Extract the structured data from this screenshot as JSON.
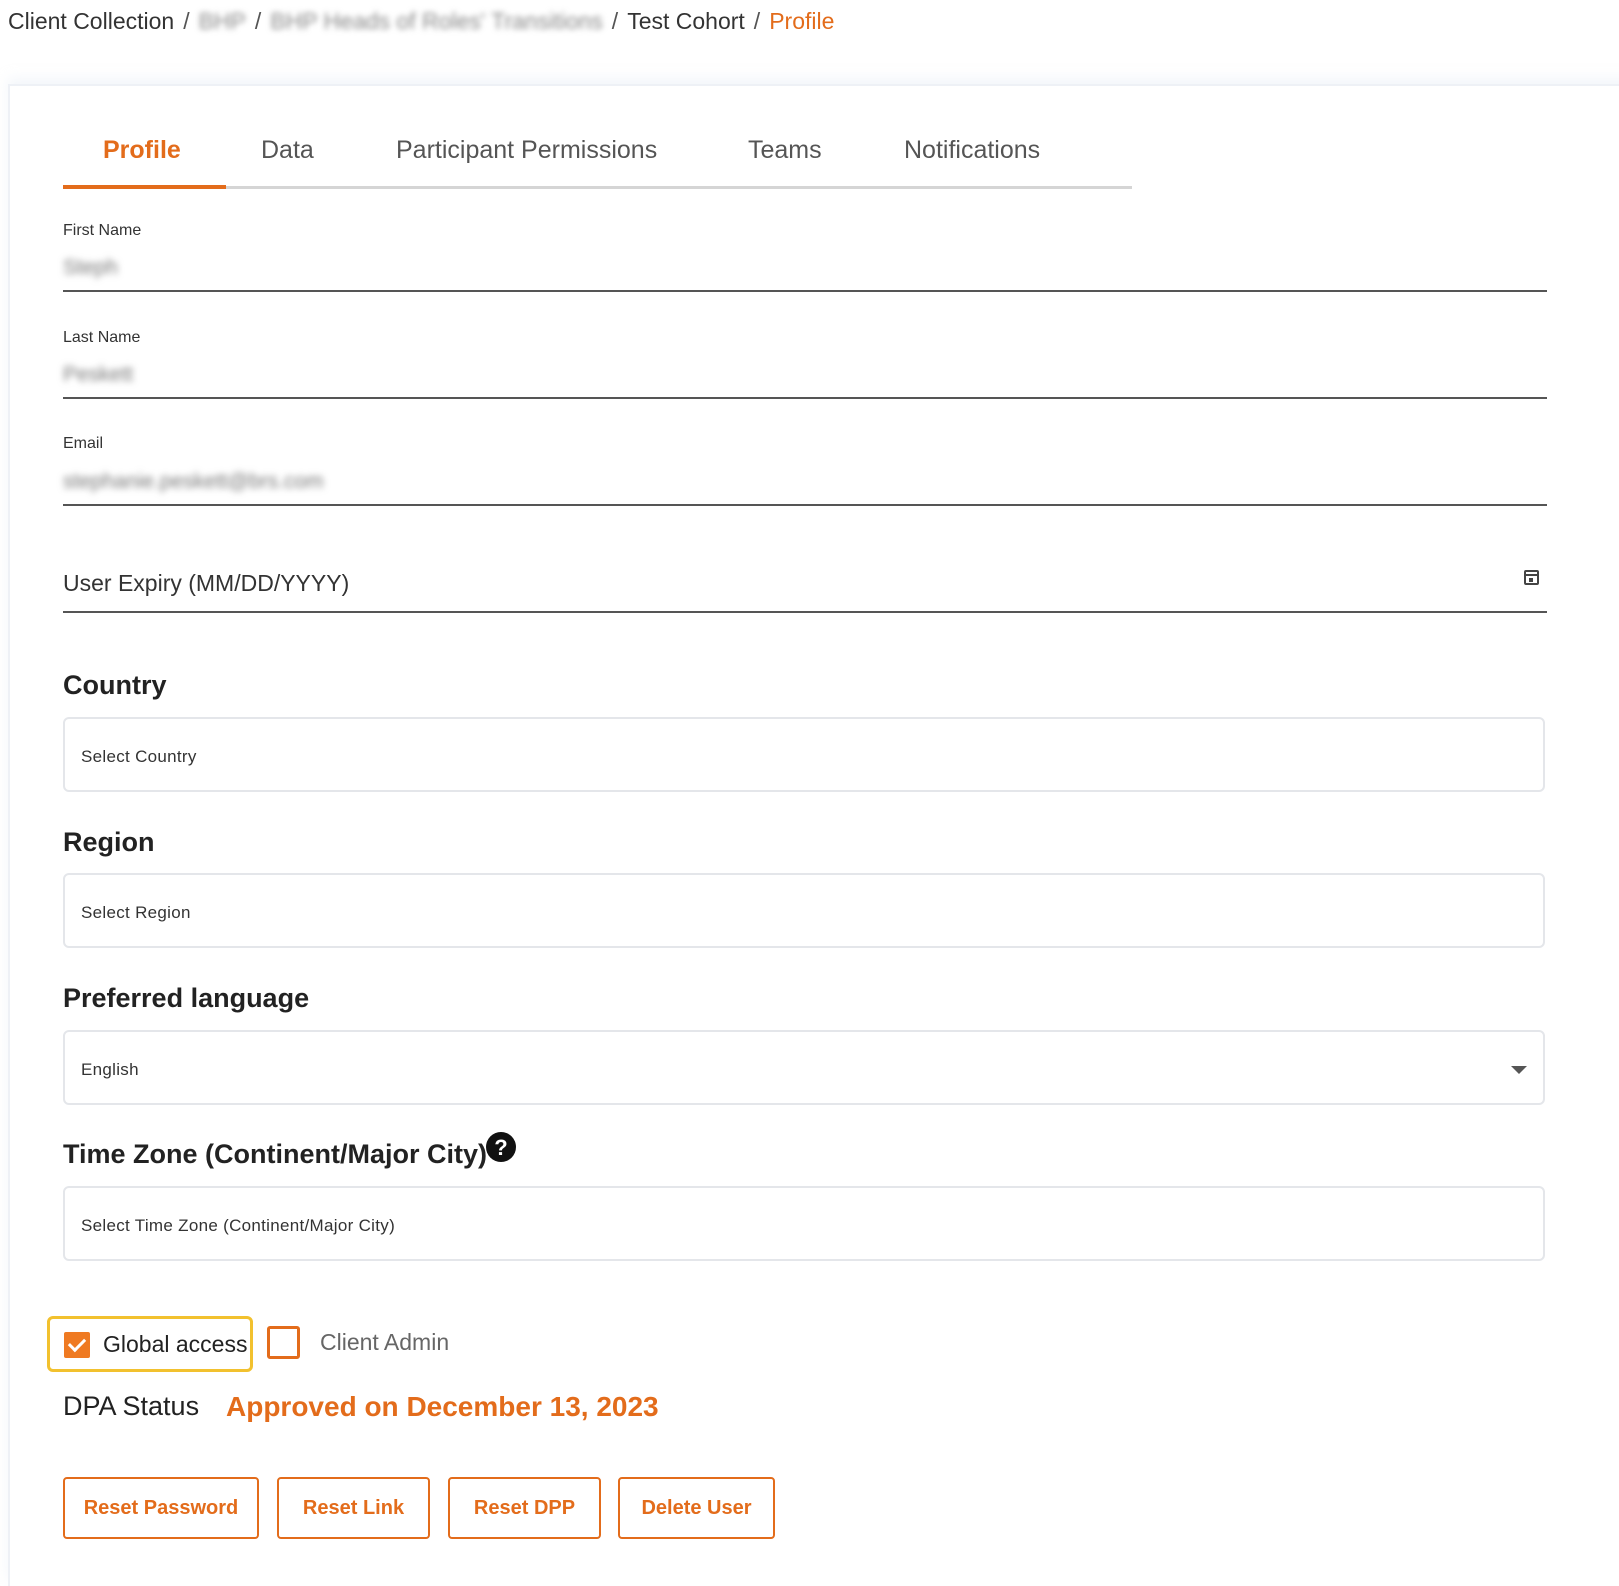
{
  "breadcrumb": {
    "items": [
      "Client Collection",
      "BHP",
      "BHP Heads of Roles' Transitions",
      "Test Cohort"
    ],
    "current": "Profile"
  },
  "tabs": [
    "Profile",
    "Data",
    "Participant Permissions",
    "Teams",
    "Notifications"
  ],
  "form": {
    "first_name": {
      "label": "First Name",
      "value": "Steph"
    },
    "last_name": {
      "label": "Last Name",
      "value": "Peskett"
    },
    "email": {
      "label": "Email",
      "value": "stephanie.peskett@brs.com"
    },
    "user_expiry": {
      "label": "User Expiry (MM/DD/YYYY)"
    },
    "country": {
      "title": "Country",
      "placeholder": "Select Country"
    },
    "region": {
      "title": "Region",
      "placeholder": "Select Region"
    },
    "language": {
      "title": "Preferred language",
      "value": "English"
    },
    "timezone": {
      "title": "Time Zone (Continent/Major City)",
      "placeholder": "Select Time Zone (Continent/Major City)",
      "help": "?"
    }
  },
  "checkboxes": {
    "global_access": {
      "label": "Global access",
      "checked": true
    },
    "client_admin": {
      "label": "Client Admin",
      "checked": false
    }
  },
  "dpa": {
    "label": "DPA Status",
    "value": "Approved on December 13, 2023"
  },
  "buttons": [
    "Reset Password",
    "Reset Link",
    "Reset DPP",
    "Delete User"
  ],
  "colors": {
    "accent": "#e36c1b",
    "highlight": "#f2c12e"
  }
}
